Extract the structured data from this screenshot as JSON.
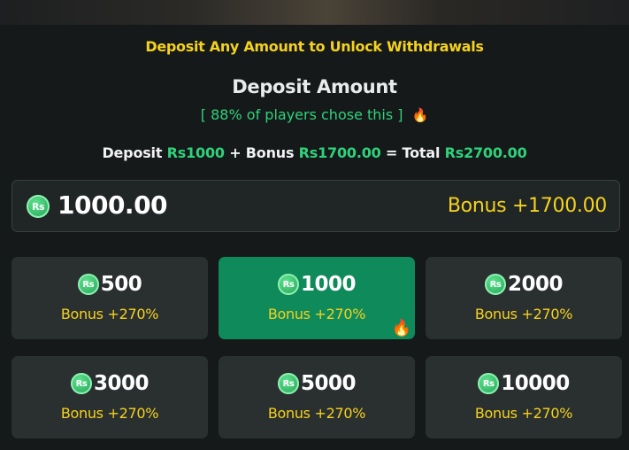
{
  "notice": "Deposit Any Amount to Unlock Withdrawals",
  "title": "Deposit Amount",
  "popular_text": "[ 88% of players chose this ]",
  "popular_icon": "fire-icon",
  "summary": {
    "deposit_label": "Deposit ",
    "deposit_value": "Rs1000",
    "bonus_label": " + Bonus ",
    "bonus_value": "Rs1700.00",
    "total_label": " = Total ",
    "total_value": "Rs2700.00"
  },
  "currency_badge": "Rs",
  "amount_input": {
    "value": "1000.00",
    "bonus": "Bonus +1700.00"
  },
  "options": [
    {
      "amount": "500",
      "bonus": "Bonus +270%",
      "selected": false
    },
    {
      "amount": "1000",
      "bonus": "Bonus +270%",
      "selected": true,
      "hot": true
    },
    {
      "amount": "2000",
      "bonus": "Bonus +270%",
      "selected": false
    },
    {
      "amount": "3000",
      "bonus": "Bonus +270%",
      "selected": false
    },
    {
      "amount": "5000",
      "bonus": "Bonus +270%",
      "selected": false
    },
    {
      "amount": "10000",
      "bonus": "Bonus +270%",
      "selected": false
    }
  ],
  "colors": {
    "accent_green": "#2fd27a",
    "selected_bg": "#0f8a5b",
    "bonus_yellow": "#f5d21e",
    "card_bg": "#2a2f30",
    "page_bg": "#15191a"
  }
}
